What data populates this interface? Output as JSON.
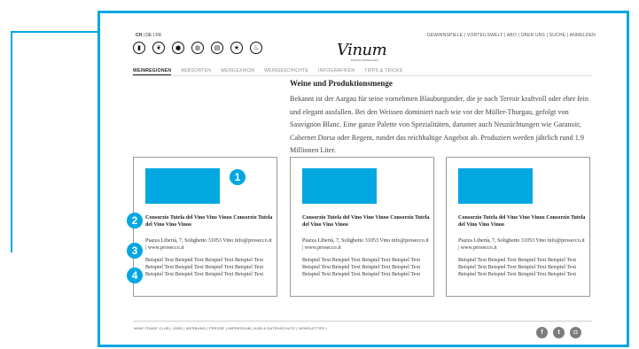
{
  "languages": {
    "active": "CH",
    "rest": " | DE | FR"
  },
  "topnav": "GEWINNSPIELE | VORTEILSWELT | ABO | ÜBER UNS | SUCHE | ANMELDEN",
  "icons": [
    {
      "name": "wine-bottle-icon",
      "glyph": "▮"
    },
    {
      "name": "sparkling-icon",
      "glyph": "❦"
    },
    {
      "name": "wine-glass-icon",
      "glyph": "●"
    },
    {
      "name": "grape-icon",
      "glyph": "◍"
    },
    {
      "name": "book-icon",
      "glyph": "▤"
    },
    {
      "name": "star-icon",
      "glyph": "★"
    },
    {
      "name": "fire-icon",
      "glyph": "♨"
    }
  ],
  "logo": {
    "text": "Vinum",
    "sub": "EUROPAS WEINMAGAZIN"
  },
  "tabs": [
    {
      "label": "WEINREGIONEN",
      "active": true
    },
    {
      "label": "REBSORTEN",
      "active": false
    },
    {
      "label": "WEINLEXIKON",
      "active": false
    },
    {
      "label": "WEINGESCHICHTE",
      "active": false
    },
    {
      "label": "INFOGRAFIKEN",
      "active": false
    },
    {
      "label": "TIPPS & TRICKS",
      "active": false
    }
  ],
  "heading": "Weine und Produktionsmenge",
  "paragraph": "Bekannt ist der Aargau für seine vornehmen Blauburgunder, die je nach Terroir kraftvoll oder eher fein und elegant ausfallen. Bei den Weissen dominiert nach wie vor der Müller-Thurgau, gefolgt von Sauvignon Blanc. Eine ganze Palette von Spezialitäten, darunter auch Neuzüchtungen wie Garanoir, Cabernet Dorsa oder Regent, rundet das reichhaltige Angebot ab. Produziert werden jährlich rund 1.9 Millionen Liter.",
  "cards": [
    {
      "name": "Consorzio Tutela del Vino Vino Vinoo Consorzio Tutela del Vino Vino Vinoo",
      "address": "Piazza Libertà, 7, Solighetto 31053 Vino info@prosecco.it | www.prosecco.it",
      "description": "Beispiel Text Beispiel Text Beispiel Text Beispiel Text Beispiel Text Beispiel Text Beispiel Text Beispiel Text Beispiel Text Beispiel Text Beispiel Text Beispiel Text"
    },
    {
      "name": "Consorzio Tutela del Vino Vino Vinoo Consorzio Tutela del Vino Vino Vinoo",
      "address": "Piazza Libertà, 7, Solighetto 31053 Vino info@prosecco.it | www.prosecco.it",
      "description": "Beispiel Text Beispiel Text Beispiel Text Beispiel Text Beispiel Text Beispiel Text Beispiel Text Beispiel Text Beispiel Text Beispiel Text Beispiel Text Beispiel Text"
    },
    {
      "name": "Consorzio Tutela del Vino Vino Vinoo Consorzio Tutela del Vino Vino Vinoo",
      "address": "Piazza Libertà, 7, Solighetto 31053 Vino info@prosecco.it | www.prosecco.it",
      "description": "Beispiel Text Beispiel Text Beispiel Text Beispiel Text Beispiel Text Beispiel Text Beispiel Text Beispiel Text Beispiel Text Beispiel Text Beispiel Text Beispiel Text"
    }
  ],
  "badges": [
    "1",
    "2",
    "3",
    "4"
  ],
  "footer": "WINE TRADE CLUB | JOBS | WERBUNG | PRESSE | IMPRESSUM | AGB & DATENSCHUTZ | NEWSLETTER |",
  "social": [
    {
      "name": "facebook-icon",
      "glyph": "f"
    },
    {
      "name": "twitter-icon",
      "glyph": "t"
    },
    {
      "name": "instagram-icon",
      "glyph": "◘"
    }
  ],
  "colors": {
    "accent": "#00a7e1",
    "social": "#7c7c7c"
  }
}
